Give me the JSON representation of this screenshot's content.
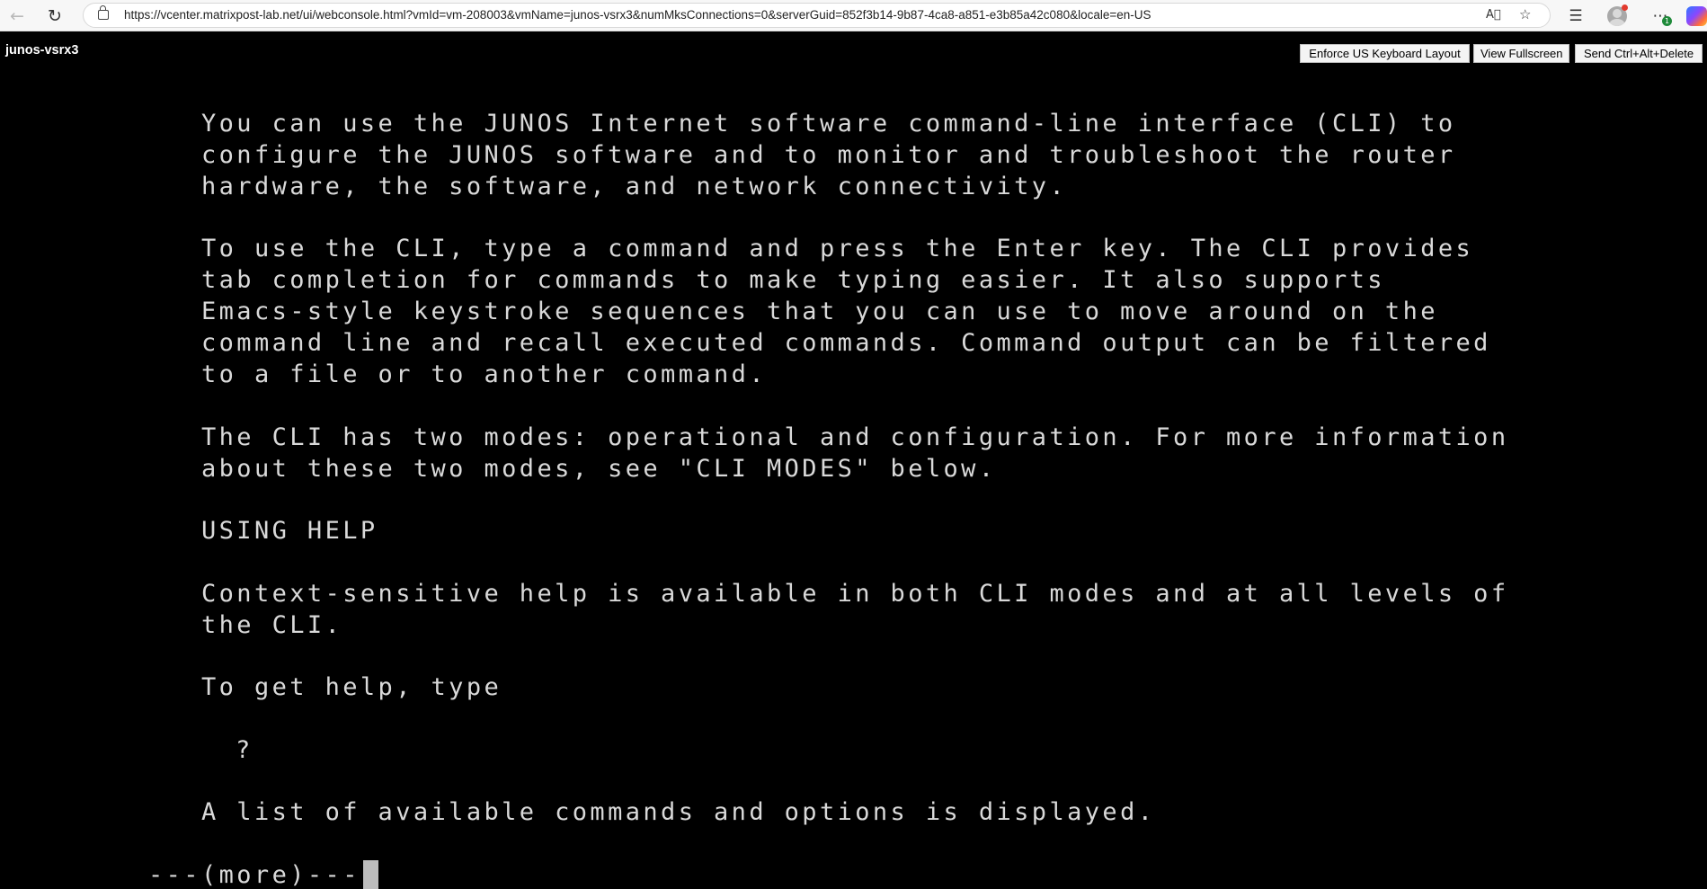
{
  "browser": {
    "url": "https://vcenter.matrixpost-lab.net/ui/webconsole.html?vmId=vm-208003&vmName=junos-vsrx3&numMksConnections=0&serverGuid=852f3b14-9b87-4ca8-a851-e3b85a42c080&locale=en-US",
    "icons": [
      "back-icon",
      "refresh-icon",
      "lock-icon",
      "read-aloud-icon",
      "favorite-star-icon",
      "favorites-icon",
      "profile-avatar",
      "extensions-icon",
      "copilot-icon"
    ],
    "extensions_badge": "1"
  },
  "console": {
    "vm_name": "junos-vsrx3",
    "buttons": {
      "keyboard_layout": "Enforce US Keyboard Layout",
      "fullscreen": "View Fullscreen",
      "ctrl_alt_del": "Send Ctrl+Alt+Delete"
    }
  },
  "terminal": {
    "lines": [
      "You can use the JUNOS Internet software command-line interface (CLI) to",
      "configure the JUNOS software and to monitor and troubleshoot the router",
      "hardware, the software, and network connectivity.",
      "To use the CLI, type a command and press the Enter key. The CLI provides",
      "tab completion for commands to make typing easier. It also supports",
      "Emacs-style keystroke sequences that you can use to move around on the",
      "command line and recall executed commands. Command output can be filtered",
      "to a file or to another command.",
      "The CLI has two modes: operational and configuration. For more information",
      "about these two modes, see \"CLI MODES\" below.",
      "USING HELP",
      "Context-sensitive help is available in both CLI modes and at all levels of",
      "the CLI.",
      "To get help, type",
      "?",
      "A list of available commands and options is displayed.",
      "---(more)---"
    ]
  }
}
